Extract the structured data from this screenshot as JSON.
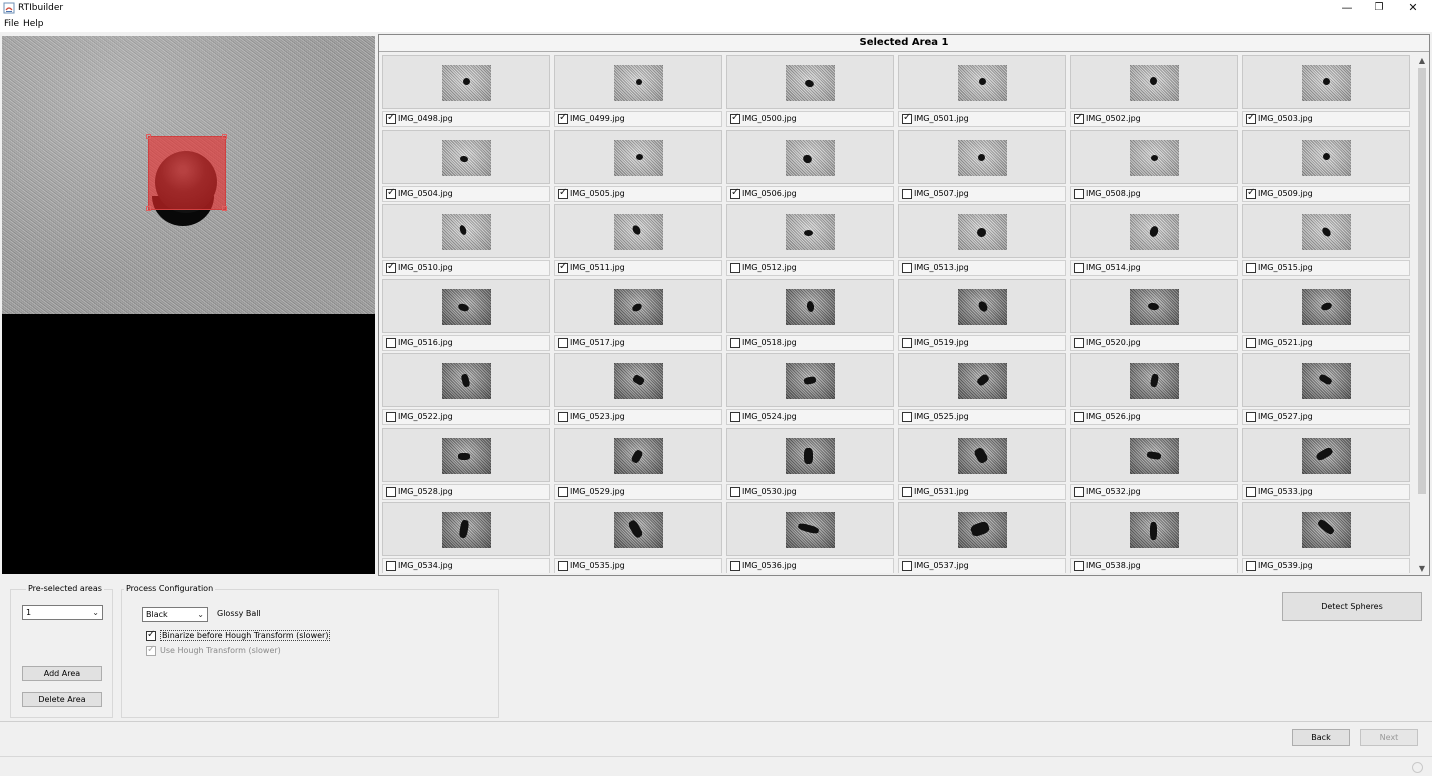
{
  "window": {
    "title": "RTIbuilder",
    "minimize": "—",
    "restore": "❐",
    "close": "✕"
  },
  "menu": {
    "items": [
      "File",
      "Help"
    ]
  },
  "panel": {
    "title": "Selected Area 1"
  },
  "thumbnails": [
    {
      "name": "IMG_0498.jpg",
      "checked": true
    },
    {
      "name": "IMG_0499.jpg",
      "checked": true
    },
    {
      "name": "IMG_0500.jpg",
      "checked": true
    },
    {
      "name": "IMG_0501.jpg",
      "checked": true
    },
    {
      "name": "IMG_0502.jpg",
      "checked": true
    },
    {
      "name": "IMG_0503.jpg",
      "checked": true
    },
    {
      "name": "IMG_0504.jpg",
      "checked": true
    },
    {
      "name": "IMG_0505.jpg",
      "checked": true
    },
    {
      "name": "IMG_0506.jpg",
      "checked": true
    },
    {
      "name": "IMG_0507.jpg",
      "checked": false
    },
    {
      "name": "IMG_0508.jpg",
      "checked": false
    },
    {
      "name": "IMG_0509.jpg",
      "checked": true
    },
    {
      "name": "IMG_0510.jpg",
      "checked": true
    },
    {
      "name": "IMG_0511.jpg",
      "checked": true
    },
    {
      "name": "IMG_0512.jpg",
      "checked": false
    },
    {
      "name": "IMG_0513.jpg",
      "checked": false
    },
    {
      "name": "IMG_0514.jpg",
      "checked": false
    },
    {
      "name": "IMG_0515.jpg",
      "checked": false
    },
    {
      "name": "IMG_0516.jpg",
      "checked": false
    },
    {
      "name": "IMG_0517.jpg",
      "checked": false
    },
    {
      "name": "IMG_0518.jpg",
      "checked": false
    },
    {
      "name": "IMG_0519.jpg",
      "checked": false
    },
    {
      "name": "IMG_0520.jpg",
      "checked": false
    },
    {
      "name": "IMG_0521.jpg",
      "checked": false
    },
    {
      "name": "IMG_0522.jpg",
      "checked": false
    },
    {
      "name": "IMG_0523.jpg",
      "checked": false
    },
    {
      "name": "IMG_0524.jpg",
      "checked": false
    },
    {
      "name": "IMG_0525.jpg",
      "checked": false
    },
    {
      "name": "IMG_0526.jpg",
      "checked": false
    },
    {
      "name": "IMG_0527.jpg",
      "checked": false
    },
    {
      "name": "IMG_0528.jpg",
      "checked": false
    },
    {
      "name": "IMG_0529.jpg",
      "checked": false
    },
    {
      "name": "IMG_0530.jpg",
      "checked": false
    },
    {
      "name": "IMG_0531.jpg",
      "checked": false
    },
    {
      "name": "IMG_0532.jpg",
      "checked": false
    },
    {
      "name": "IMG_0533.jpg",
      "checked": false
    },
    {
      "name": "IMG_0534.jpg",
      "checked": false
    },
    {
      "name": "IMG_0535.jpg",
      "checked": false
    },
    {
      "name": "IMG_0536.jpg",
      "checked": false
    },
    {
      "name": "IMG_0537.jpg",
      "checked": false
    },
    {
      "name": "IMG_0538.jpg",
      "checked": false
    },
    {
      "name": "IMG_0539.jpg",
      "checked": false
    }
  ],
  "preselected": {
    "legend": "Pre-selected areas",
    "selected": "1",
    "add": "Add Area",
    "delete": "Delete Area"
  },
  "process": {
    "legend": "Process Configuration",
    "color": "Black",
    "type_label": "Glossy Ball",
    "binarize": {
      "label": "Binarize before Hough Transform (slower)",
      "checked": true
    },
    "hough": {
      "label": "Use Hough Transform (slower)",
      "checked": true,
      "enabled": false
    }
  },
  "actions": {
    "detect": "Detect Spheres",
    "back": "Back",
    "next": "Next"
  },
  "colors": {
    "selection": "#e62828",
    "background": "#f0f0f0"
  }
}
